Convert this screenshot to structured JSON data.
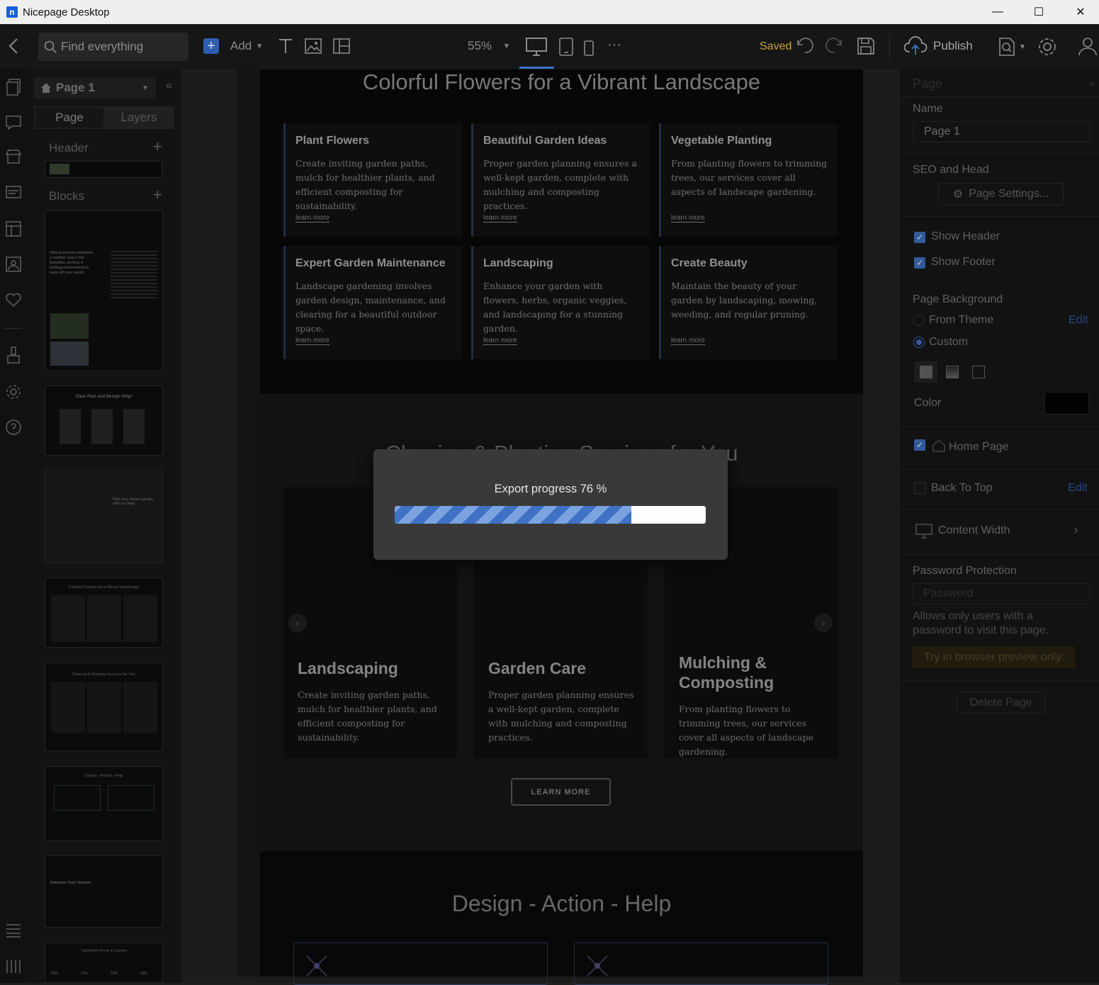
{
  "window": {
    "title": "Nicepage Desktop",
    "minimize": "—",
    "maximize": "☐",
    "close": "✕"
  },
  "toolbar": {
    "search_placeholder": "Find everything",
    "add_label": "Add",
    "zoom": "55%",
    "more": "···",
    "saved_label": "Saved",
    "publish_label": "Publish"
  },
  "left_panel": {
    "page_select": "Page 1",
    "tabs": [
      "Page",
      "Layers"
    ],
    "header_label": "Header",
    "blocks_label": "Blocks",
    "thumbs": [
      {
        "title": "",
        "text": "Olda Sycamore transform a outdoor space into beautiful, exciting & inviting environment to enjoy all year round."
      },
      {
        "title": "Clear Plan and Design Help!"
      },
      {
        "title": "Plan your dream garden with our help"
      },
      {
        "title": "Colorful Flowers for a Vibrant Landscape"
      },
      {
        "title": "Clearing & Planting Services for You"
      },
      {
        "title": "Design - Action - Help"
      },
      {
        "title": "Enhance Your Garden"
      },
      {
        "title": "Transform Home & Garden",
        "stats": [
          "40%",
          "15%",
          "15%",
          "30%"
        ]
      }
    ]
  },
  "canvas": {
    "section1_title": "Colorful Flowers for a Vibrant Landscape",
    "cards": [
      {
        "title": "Plant Flowers",
        "text": "Create inviting garden paths, mulch for healthier plants, and efficient composting for sustainability.",
        "link": "learn more"
      },
      {
        "title": "Beautiful Garden Ideas",
        "text": "Proper garden planning ensures a well-kept garden, complete with mulching and composting practices.",
        "link": "learn more"
      },
      {
        "title": "Vegetable Planting",
        "text": "From planting flowers to trimming trees, our services cover all aspects of landscape gardening.",
        "link": "learn more"
      },
      {
        "title": "Expert Garden Maintenance",
        "text": "Landscape gardening involves garden design, maintenance, and clearing for a beautiful outdoor space.",
        "link": "learn more"
      },
      {
        "title": "Landscaping",
        "text": "Enhance your garden with flowers, herbs, organic veggies, and landscaping for a stunning garden.",
        "link": "learn more"
      },
      {
        "title": "Create Beauty",
        "text": "Maintain the beauty of your garden by landscaping, mowing, weeding, and regular pruning.",
        "link": "learn more"
      }
    ],
    "section2_title": "Clearing & Planting Services for You",
    "services": [
      {
        "title": "Landscaping",
        "text": "Create inviting garden paths, mulch for healthier plants, and efficient composting for sustainability."
      },
      {
        "title": "Garden Care",
        "text": "Proper garden planning ensures a well-kept garden, complete with mulching and composting practices."
      },
      {
        "title": "Mulching & Composting",
        "text": "From planting flowers to trimming trees, our services cover all aspects of landscape gardening."
      }
    ],
    "learn_more_button": "LEARN MORE",
    "section3_title": "Design - Action - Help"
  },
  "right_panel": {
    "heading": "Page",
    "name_label": "Name",
    "name_value": "Page 1",
    "seo_label": "SEO and Head",
    "page_settings_button": "Page Settings...",
    "show_header": "Show Header",
    "show_header_checked": true,
    "show_footer": "Show Footer",
    "show_footer_checked": true,
    "page_background": "Page Background",
    "from_theme": "From Theme",
    "edit_label": "Edit",
    "custom": "Custom",
    "background_mode": "Custom",
    "color_label": "Color",
    "color_value": "#050505",
    "home_page": "Home Page",
    "home_page_checked": true,
    "back_to_top": "Back To Top",
    "back_to_top_checked": false,
    "content_width": "Content Width",
    "password_protection": "Password Protection",
    "password_placeholder": "Password",
    "password_help": "Allows only users with a password to visit this page.",
    "try_preview": "Try in browser preview only.",
    "delete_page": "Delete Page"
  },
  "export_dialog": {
    "label": "Export progress 76 %",
    "progress": 0.76
  },
  "colors": {
    "accent": "#3f74c9",
    "saved": "#c8a23a",
    "progress_stripe": "#3f72c4"
  }
}
